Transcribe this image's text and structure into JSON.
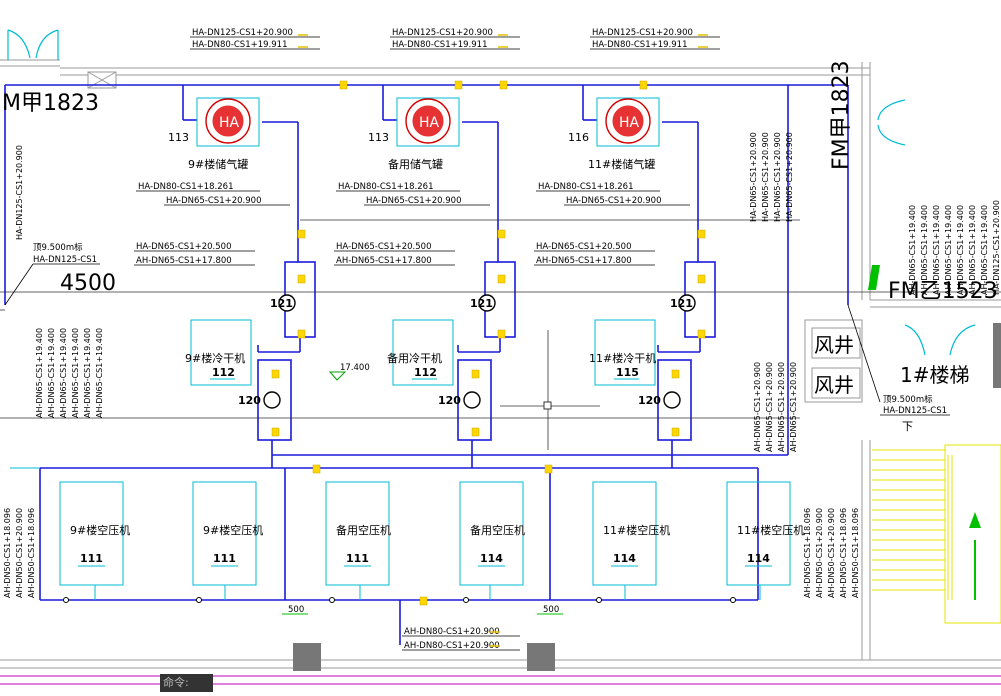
{
  "top_header_labels": [
    [
      "HA-DN125-CS1+20.900",
      "HA-DN80-CS1+19.911"
    ],
    [
      "HA-DN125-CS1+20.900",
      "HA-DN80-CS1+19.911"
    ],
    [
      "HA-DN125-CS1+20.900",
      "HA-DN80-CS1+19.911"
    ]
  ],
  "tank_symbol": "HA",
  "tank_codes": [
    "113",
    "113",
    "116"
  ],
  "tank_names": [
    "9#楼储气罐",
    "备用储气罐",
    "11#楼储气罐"
  ],
  "tank_pipe_labels": [
    [
      "HA-DN80-CS1+18.261",
      "HA-DN65-CS1+20.900"
    ],
    [
      "HA-DN80-CS1+18.261",
      "HA-DN65-CS1+20.900"
    ],
    [
      "HA-DN80-CS1+18.261",
      "HA-DN65-CS1+20.900"
    ]
  ],
  "dryer_pipe_labels": [
    [
      "HA-DN65-CS1+20.500",
      "AH-DN65-CS1+17.800"
    ],
    [
      "HA-DN65-CS1+20.500",
      "AH-DN65-CS1+17.800"
    ],
    [
      "HA-DN65-CS1+20.500",
      "AH-DN65-CS1+17.800"
    ]
  ],
  "filter_codes": [
    "121",
    "121",
    "121"
  ],
  "filter2_codes": [
    "120",
    "120",
    "120"
  ],
  "dryer_names": [
    "9#楼冷干机",
    "备用冷干机",
    "11#楼冷干机"
  ],
  "dryer_codes": [
    "112",
    "112",
    "115"
  ],
  "compressor_names": [
    "9#楼空压机",
    "9#楼空压机",
    "备用空压机",
    "备用空压机",
    "11#楼空压机",
    "11#楼空压机"
  ],
  "compressor_codes": [
    "111",
    "111",
    "111",
    "114",
    "114",
    "114"
  ],
  "door_left": "M甲1823",
  "door_right": "FM甲1823",
  "door_right2": "FM乙1523",
  "dim_4500": "4500",
  "elev_left": "顶9.500m标",
  "elev_left_pipe": "HA-DN125-CS1",
  "elev_left_vertical": "HA-DN125-CS1+20.900",
  "elev_right": "顶9.500m标",
  "elev_right_pipe": "HA-DN125-CS1",
  "level_mark": "17.400",
  "shaft_labels": [
    "风井",
    "风井"
  ],
  "stair_label": "1#楼梯",
  "stair_down": "下",
  "dim_500": [
    "500",
    "500"
  ],
  "bottom_labels": [
    "AH-DN80-CS1+20.900",
    "AH-DN80-CS1+20.900"
  ],
  "left_vertical_group": [
    "AH-DN65-CS1+19.400",
    "AH-DN65-CS1+19.400",
    "AH-DN65-CS1+19.400",
    "AH-DN65-CS1+19.400",
    "AH-DN65-CS1+19.400",
    "AH-DN65-CS1+19.400"
  ],
  "left_bottom_vertical_group": [
    "AH-DN50-CS1+18.096",
    "AH-DN50-CS1+20.900",
    "AH-DN50-CS1+18.096"
  ],
  "mid_vertical_group_top": [
    "HA-DN65-CS1+20.900",
    "HA-DN65-CS1+20.900",
    "HA-DN65-CS1+20.900",
    "HA-DN65-CS1+20.900"
  ],
  "mid_vertical_group_low": [
    "AH-DN65-CS1+20.900",
    "AH-DN65-CS1+20.900",
    "AH-DN65-CS1+20.900",
    "AH-DN65-CS1+20.900"
  ],
  "right_vertical_group": [
    "AH-DN65-CS1+19.400",
    "AH-DN65-CS1+19.400",
    "AH-DN65-CS1+19.400",
    "AH-DN65-CS1+19.400",
    "AH-DN65-CS1+19.400",
    "AH-DN65-CS1+19.400",
    "AH-DN65-CS1+19.400",
    "HA-DN125-CS1+20.900"
  ],
  "right_bottom_vertical_group": [
    "AH-DN50-CS1+18.096",
    "AH-DN50-CS1+20.900",
    "AH-DN50-CS1+20.900",
    "AH-DN50-CS1+18.096",
    "AH-DN50-CS1+18.096"
  ],
  "command_label": "命令:"
}
